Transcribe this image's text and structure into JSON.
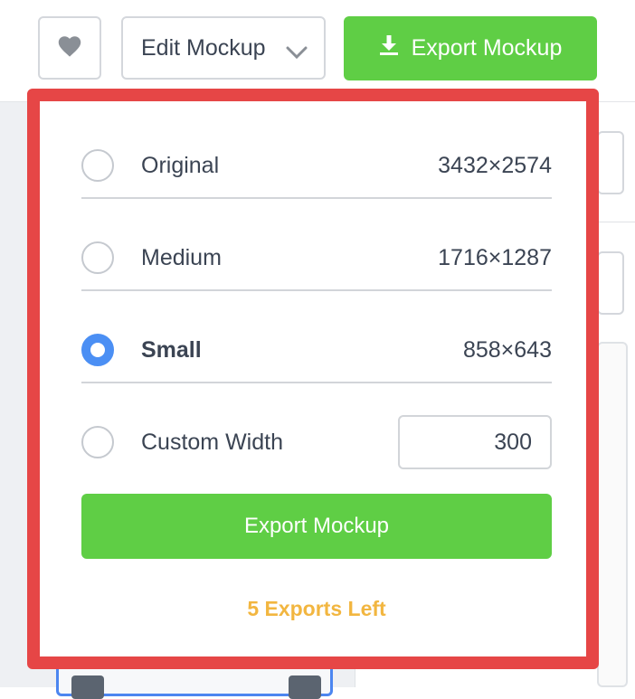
{
  "toolbar": {
    "favorite_icon": "heart-icon",
    "edit_label": "Edit Mockup",
    "edit_icon": "chevron-down-icon",
    "export_label": "Export Mockup",
    "export_icon": "download-icon"
  },
  "export_panel": {
    "options": [
      {
        "label": "Original",
        "size": "3432×2574",
        "selected": false
      },
      {
        "label": "Medium",
        "size": "1716×1287",
        "selected": false
      },
      {
        "label": "Small",
        "size": "858×643",
        "selected": true
      },
      {
        "label": "Custom Width",
        "value": "300",
        "selected": false
      }
    ],
    "export_button_label": "Export Mockup",
    "exports_left": "5 Exports Left"
  },
  "colors": {
    "accent_green": "#5fce45",
    "highlight_red": "#e64646",
    "radio_selected": "#4b8ff4",
    "warning_orange": "#f2b640"
  }
}
